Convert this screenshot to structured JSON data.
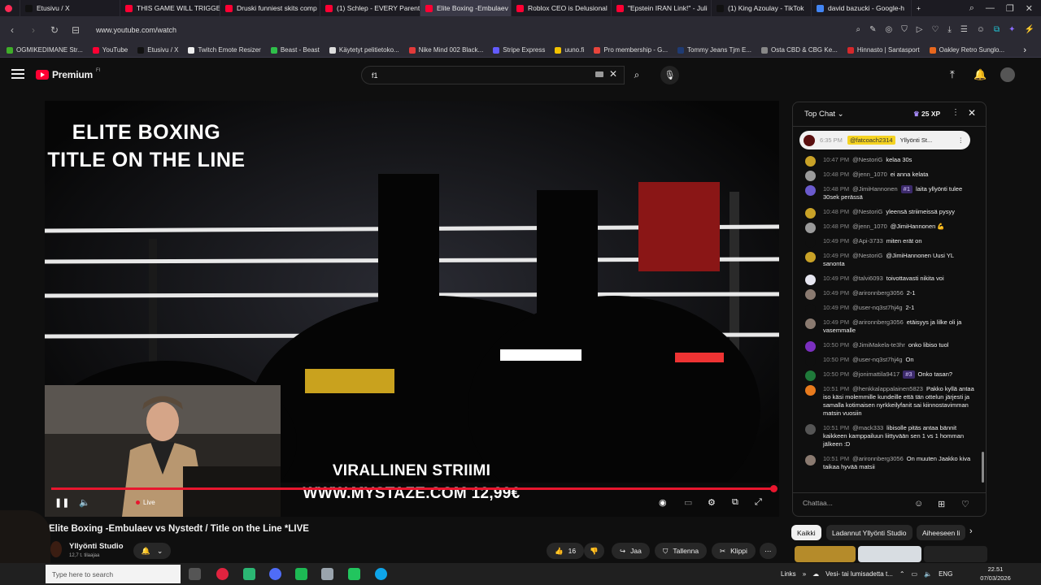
{
  "browser": {
    "tabs": [
      {
        "label": "Etusivu / X",
        "color": "#111111"
      },
      {
        "label": "THIS GAME WILL TRIGGER",
        "color": "#ff0033"
      },
      {
        "label": "Druski funniest skits comp",
        "color": "#ff0033"
      },
      {
        "label": "(1) Schlep - EVERY Parent",
        "color": "#ff0033"
      },
      {
        "label": "Elite Boxing -Embulaev",
        "color": "#ff0033",
        "active": true
      },
      {
        "label": "Roblox CEO is Delusional",
        "color": "#ff0033"
      },
      {
        "label": "\"Epstein IRAN Link!\" - Juli",
        "color": "#ff0033"
      },
      {
        "label": "(1) King Azoulay - TikTok",
        "color": "#111111"
      },
      {
        "label": "david bazucki - Google-h",
        "color": "#4285f4"
      }
    ],
    "url": "www.youtube.com/watch",
    "bookmarks": [
      {
        "label": "OGMIKEDIMANE Str...",
        "color": "#3fae29"
      },
      {
        "label": "YouTube",
        "color": "#ff0033"
      },
      {
        "label": "Etusivu / X",
        "color": "#111111"
      },
      {
        "label": "Twitch Emote Resizer",
        "color": "#eeeeee"
      },
      {
        "label": "Beast - Beast",
        "color": "#2fbf4a"
      },
      {
        "label": "Käytetyt pelitietoko...",
        "color": "#dddddd"
      },
      {
        "label": "Nike Mind 002 Black...",
        "color": "#e23a3a"
      },
      {
        "label": "Stripe Express",
        "color": "#635bff"
      },
      {
        "label": "uuno.fi",
        "color": "#f2c200"
      },
      {
        "label": "Pro membership - G...",
        "color": "#e8453c"
      },
      {
        "label": "Tommy Jeans Tjm E...",
        "color": "#1f3b73"
      },
      {
        "label": "Osta CBD & CBG Ke...",
        "color": "#888888"
      },
      {
        "label": "Hinnasto | Santasport",
        "color": "#d6282b"
      },
      {
        "label": "Oakley Retro Sunglo...",
        "color": "#e8671d"
      }
    ]
  },
  "youtube": {
    "logo_text": "Premium",
    "country_code": "FI",
    "search_value": "f1"
  },
  "video": {
    "overlay_title_line1": "ELITE BOXING",
    "overlay_title_line2": "TITLE ON THE LINE",
    "overlay_promo_line1": "VIRALLINEN STRIIMI",
    "overlay_promo_line2": "WWW.MYSTAZE.COM 12,99€",
    "live_label": "Live",
    "progress": 1.0,
    "title": "Elite Boxing -Embulaev vs Nystedt / Title on the Line *LIVE",
    "channel_name": "Yllyönti Studio",
    "subscribers": "12,7 t. tilaajaa",
    "likes": "16",
    "share_label": "Jaa",
    "save_label": "Tallenna",
    "clip_label": "Klippi"
  },
  "chat": {
    "title": "Top Chat",
    "xp": "25 XP",
    "pinned_time": "6:35 PM",
    "pinned_user": "@fatcoach2314",
    "pinned_text": "Yllyönti St...",
    "input_placeholder": "Chattaa...",
    "messages": [
      {
        "time": "10:47 PM",
        "author": "@NestoriG",
        "text": "kelaa 30s",
        "avatar": "#c9a227"
      },
      {
        "time": "10:48 PM",
        "author": "@jenn_1070",
        "text": "ei anna kelata",
        "avatar": "#9a9a9a"
      },
      {
        "time": "10:48 PM",
        "author": "@JimiHannonen",
        "badge": "#1",
        "text": "laita yllyönti tulee 30sek perässä",
        "avatar": "#6a5acd"
      },
      {
        "time": "10:48 PM",
        "author": "@NestoriG",
        "text": "yleensä striimeissä pysyy",
        "avatar": "#c9a227"
      },
      {
        "time": "10:48 PM",
        "author": "@jenn_1070",
        "text": "@JimiHannonen 💪",
        "avatar": "#9a9a9a"
      },
      {
        "time": "10:49 PM",
        "author": "@Api-3733",
        "text": "miten erät on",
        "avatar": "#0f0f0f"
      },
      {
        "time": "10:49 PM",
        "author": "@NestoriG",
        "text": "@JimiHannonen Uusi YL sanonta",
        "avatar": "#c9a227"
      },
      {
        "time": "10:49 PM",
        "author": "@talvi6093",
        "text": "toivottavasti nikita voi",
        "avatar": "#e6e6f0"
      },
      {
        "time": "10:49 PM",
        "author": "@arironnberg3056",
        "text": "2-1",
        "avatar": "#8a7a70"
      },
      {
        "time": "10:49 PM",
        "author": "@user-nq3st7hj4g",
        "text": "2-1",
        "avatar": "#0f0f0f"
      },
      {
        "time": "10:49 PM",
        "author": "@arironnberg3056",
        "text": "etäisyys ja lilke oli ja vasemmalle",
        "avatar": "#8a7a70"
      },
      {
        "time": "10:50 PM",
        "author": "@JimiMakela-te3hr",
        "text": "onko libiso tuol",
        "avatar": "#7b2fbf"
      },
      {
        "time": "10:50 PM",
        "author": "@user-nq3st7hj4g",
        "text": "On",
        "avatar": "#0f0f0f"
      },
      {
        "time": "10:50 PM",
        "author": "@jonimattila9417",
        "badge": "#3",
        "text": "Onko tasan?",
        "avatar": "#1f7a3a"
      },
      {
        "time": "10:51 PM",
        "author": "@henkkalappalainen5823",
        "text": "Pakko kyllä antaa iso käsi molemmille kundeille että tän ottelun järjesti ja samalla kotimaisen nyrkkeilyfanit sai kiinnostavimman matsin vuosiin",
        "avatar": "#e87a1d"
      },
      {
        "time": "10:51 PM",
        "author": "@mack333",
        "text": "libisolle pitäs antaa bännit kaikkeen kamppailuun liittyvään sen 1 vs 1 homman jälkeen :D",
        "avatar": "#555555"
      },
      {
        "time": "10:51 PM",
        "author": "@arironnberg3056",
        "text": "On muuten Jaakko kiva taikaa hyvää matsii",
        "avatar": "#8a7a70"
      }
    ],
    "chips": [
      {
        "label": "Kaikki",
        "selected": true
      },
      {
        "label": "Ladannut Yllyönti Studio",
        "selected": false
      },
      {
        "label": "Aiheeseen li",
        "selected": false
      }
    ]
  },
  "taskbar": {
    "search_placeholder": "Type here to search",
    "links_label": "Links",
    "notification": "Vesi- tai lumisadetta t...",
    "lang": "ENG",
    "time": "22.51",
    "date": "07/03/2026"
  },
  "icons": {
    "youtube_red": "#ff0033",
    "progress_red": "#e8162e"
  }
}
